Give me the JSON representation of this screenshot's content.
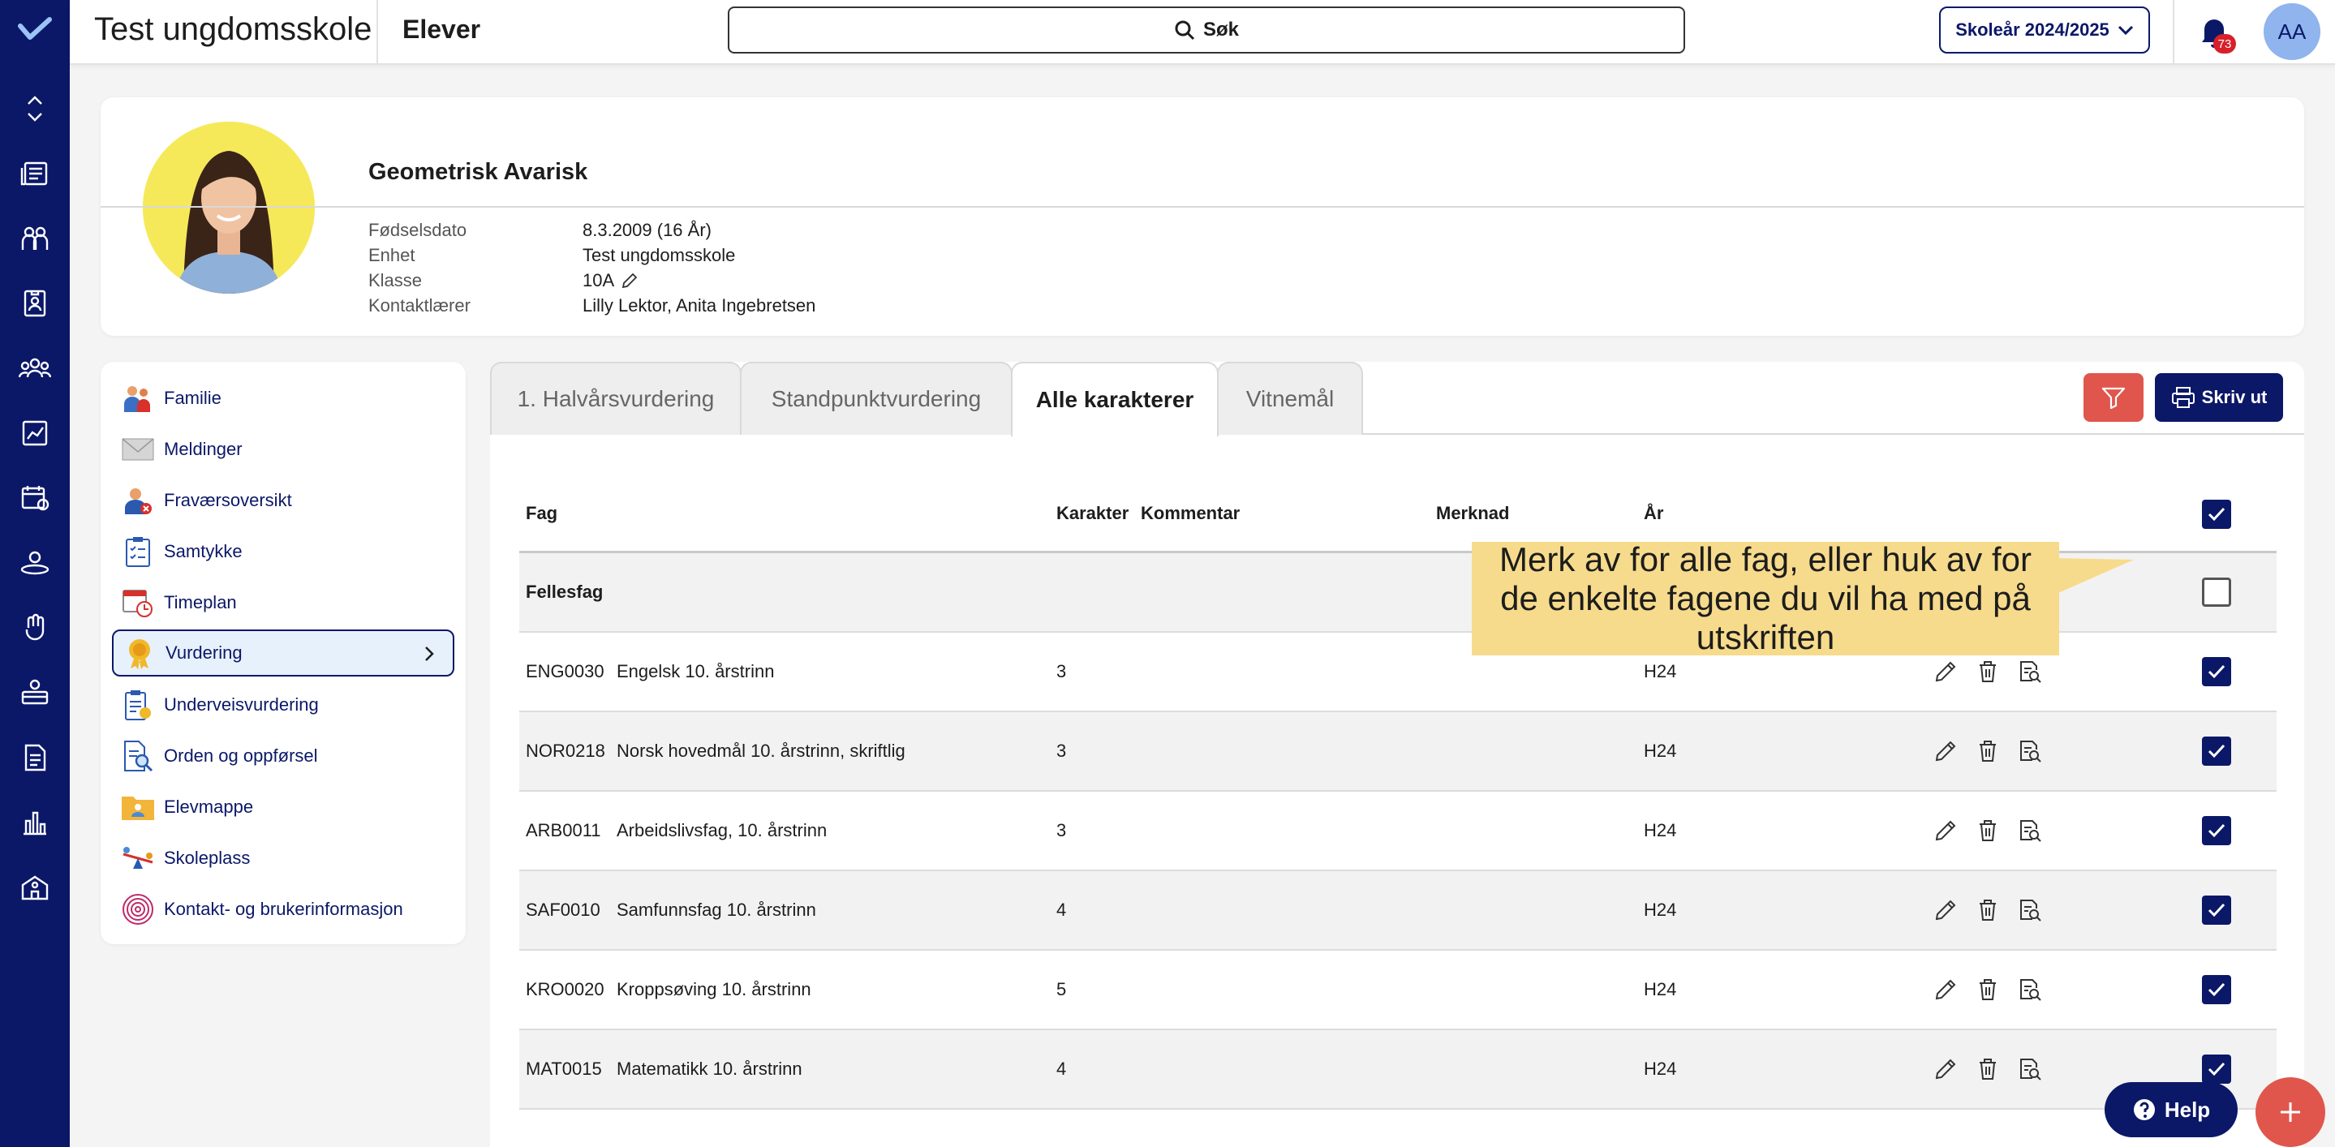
{
  "app": {
    "school": "Test ungdomsskole",
    "section": "Elever",
    "search_label": "Søk",
    "school_year": "Skoleår 2024/2025",
    "notification_count": "73",
    "user_initials": "AA"
  },
  "student": {
    "name": "Geometrisk Avarisk",
    "fields": [
      {
        "label": "Fødselsdato",
        "value": "8.3.2009 (16 År)"
      },
      {
        "label": "Enhet",
        "value": "Test ungdomsskole"
      },
      {
        "label": "Klasse",
        "value": "10A"
      },
      {
        "label": "Kontaktlærer",
        "value": "Lilly Lektor, Anita Ingebretsen"
      }
    ]
  },
  "menu": [
    {
      "label": "Familie",
      "icon": "family-icon"
    },
    {
      "label": "Meldinger",
      "icon": "envelope-icon"
    },
    {
      "label": "Fraværsoversikt",
      "icon": "absence-icon"
    },
    {
      "label": "Samtykke",
      "icon": "clipboard-icon"
    },
    {
      "label": "Timeplan",
      "icon": "calendar-clock-icon"
    },
    {
      "label": "Vurdering",
      "icon": "medal-icon",
      "active": true
    },
    {
      "label": "Underveisvurdering",
      "icon": "clipboard-medal-icon"
    },
    {
      "label": "Orden og oppførsel",
      "icon": "document-search-icon"
    },
    {
      "label": "Elevmappe",
      "icon": "folder-icon"
    },
    {
      "label": "Skoleplass",
      "icon": "seesaw-icon"
    },
    {
      "label": "Kontakt- og brukerinformasjon",
      "icon": "fingerprint-icon"
    }
  ],
  "tabs": [
    {
      "label": "1. Halvårsvurdering"
    },
    {
      "label": "Standpunktvurdering"
    },
    {
      "label": "Alle karakterer",
      "active": true
    },
    {
      "label": "Vitnemål"
    }
  ],
  "toolbar": {
    "print_label": "Skriv ut"
  },
  "table": {
    "headers": {
      "subject": "Fag",
      "grade": "Karakter",
      "comment": "Kommentar",
      "note": "Merknad",
      "year": "År"
    },
    "group_label": "Fellesfag",
    "rows": [
      {
        "code": "ENG0030",
        "name": "Engelsk 10. årstrinn",
        "grade": "3",
        "year": "H24"
      },
      {
        "code": "NOR0218",
        "name": "Norsk hovedmål 10. årstrinn, skriftlig",
        "grade": "3",
        "year": "H24"
      },
      {
        "code": "ARB0011",
        "name": "Arbeidslivsfag, 10. årstrinn",
        "grade": "3",
        "year": "H24"
      },
      {
        "code": "SAF0010",
        "name": "Samfunnsfag 10. årstrinn",
        "grade": "4",
        "year": "H24"
      },
      {
        "code": "KRO0020",
        "name": "Kroppsøving 10. årstrinn",
        "grade": "5",
        "year": "H24"
      },
      {
        "code": "MAT0015",
        "name": "Matematikk 10. årstrinn",
        "grade": "4",
        "year": "H24"
      }
    ]
  },
  "callout": "Merk av for alle fag, eller huk av for de enkelte fagene du vil ha med på utskriften",
  "help_label": "Help",
  "colors": {
    "navy": "#0b1868",
    "accent_red": "#e0564c",
    "callout": "#f7db8c"
  }
}
